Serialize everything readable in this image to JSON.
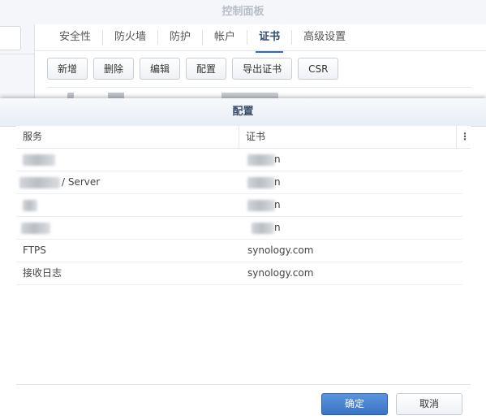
{
  "window": {
    "title": "控制面板"
  },
  "tabs": [
    {
      "label": "安全性"
    },
    {
      "label": "防火墙"
    },
    {
      "label": "防护"
    },
    {
      "label": "帐户"
    },
    {
      "label": "证书",
      "active": true
    },
    {
      "label": "高级设置"
    }
  ],
  "toolbar": {
    "add_label": "新增",
    "delete_label": "删除",
    "edit_label": "编辑",
    "configure_label": "配置",
    "export_label": "导出证书",
    "csr_label": "CSR"
  },
  "dialog": {
    "title": "配置",
    "columns": {
      "service": "服务",
      "certificate": "证书",
      "menu_glyph": "⋮"
    },
    "rows": [
      {
        "service": "",
        "certificate": "n"
      },
      {
        "service": "/ Server",
        "certificate": "n"
      },
      {
        "service": "",
        "certificate": "n"
      },
      {
        "service": "",
        "certificate": "n"
      },
      {
        "service": "FTPS",
        "certificate": "synology.com"
      },
      {
        "service": "接收日志",
        "certificate": "synology.com"
      }
    ],
    "ok_label": "确定",
    "cancel_label": "取消"
  },
  "colors": {
    "accent": "#3b74c4",
    "header_text": "#3b4f6c",
    "active_tab": "#2f4a72"
  }
}
